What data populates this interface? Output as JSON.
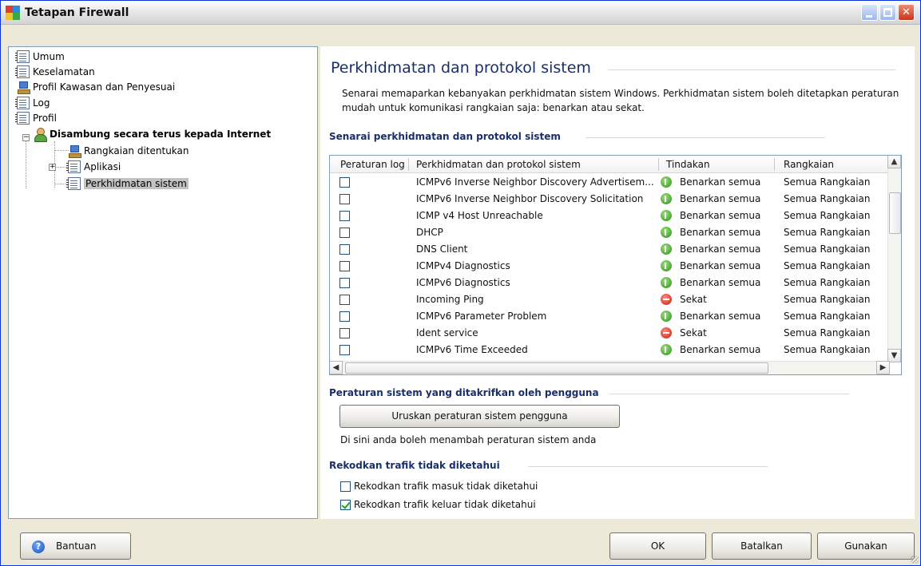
{
  "window": {
    "title": "Tetapan Firewall"
  },
  "tree": {
    "items": [
      {
        "label": "Umum"
      },
      {
        "label": "Keselamatan"
      },
      {
        "label": "Profil Kawasan dan Penyesuai"
      },
      {
        "label": "Log"
      },
      {
        "label": "Profil"
      },
      {
        "label": "Disambung secara terus kepada Internet"
      },
      {
        "label": "Rangkaian ditentukan"
      },
      {
        "label": "Aplikasi"
      },
      {
        "label": "Perkhidmatan sistem"
      }
    ]
  },
  "main": {
    "title": "Perkhidmatan dan protokol sistem",
    "description": "Senarai memaparkan kebanyakan perkhidmatan sistem Windows. Perkhidmatan sistem boleh ditetapkan peraturan mudah untuk komunikasi rangkaian saja: benarkan atau sekat.",
    "list_section_title": "Senarai perkhidmatan dan protokol sistem",
    "columns": [
      "Peraturan log",
      "Perkhidmatan dan protokol sistem",
      "Tindakan",
      "Rangkaian"
    ],
    "rows": [
      {
        "service": "ICMPv6 Inverse Neighbor Discovery Advertisem...",
        "action": "Benarkan semua",
        "action_type": "allow",
        "network": "Semua Rangkaian"
      },
      {
        "service": "ICMPv6 Inverse Neighbor Discovery Solicitation",
        "action": "Benarkan semua",
        "action_type": "allow",
        "network": "Semua Rangkaian"
      },
      {
        "service": "ICMP v4 Host Unreachable",
        "action": "Benarkan semua",
        "action_type": "allow",
        "network": "Semua Rangkaian"
      },
      {
        "service": "DHCP",
        "action": "Benarkan semua",
        "action_type": "allow",
        "network": "Semua Rangkaian"
      },
      {
        "service": "DNS Client",
        "action": "Benarkan semua",
        "action_type": "allow",
        "network": "Semua Rangkaian"
      },
      {
        "service": "ICMPv4 Diagnostics",
        "action": "Benarkan semua",
        "action_type": "allow",
        "network": "Semua Rangkaian"
      },
      {
        "service": "ICMPv6 Diagnostics",
        "action": "Benarkan semua",
        "action_type": "allow",
        "network": "Semua Rangkaian"
      },
      {
        "service": "Incoming Ping",
        "action": "Sekat",
        "action_type": "block",
        "network": "Semua Rangkaian"
      },
      {
        "service": "ICMPv6 Parameter Problem",
        "action": "Benarkan semua",
        "action_type": "allow",
        "network": "Semua Rangkaian"
      },
      {
        "service": "Ident service",
        "action": "Sekat",
        "action_type": "block",
        "network": "Semua Rangkaian"
      },
      {
        "service": "ICMPv6 Time Exceeded",
        "action": "Benarkan semua",
        "action_type": "allow",
        "network": "Semua Rangkaian"
      }
    ],
    "user_rules_title": "Peraturan sistem yang ditakrifkan oleh pengguna",
    "manage_button": "Uruskan peraturan sistem pengguna",
    "user_rules_note": "Di sini anda boleh menambah peraturan sistem anda",
    "log_section_title": "Rekodkan trafik tidak diketahui",
    "log_incoming": {
      "label": "Rekodkan trafik masuk tidak diketahui",
      "checked": false
    },
    "log_outgoing": {
      "label": "Rekodkan trafik keluar tidak diketahui",
      "checked": true
    }
  },
  "footer": {
    "help": "Bantuan",
    "ok": "OK",
    "cancel": "Batalkan",
    "apply": "Gunakan"
  },
  "colors": {
    "allow": "#2e8f1a",
    "block": "#c91e10",
    "heading": "#1a2f6a"
  }
}
